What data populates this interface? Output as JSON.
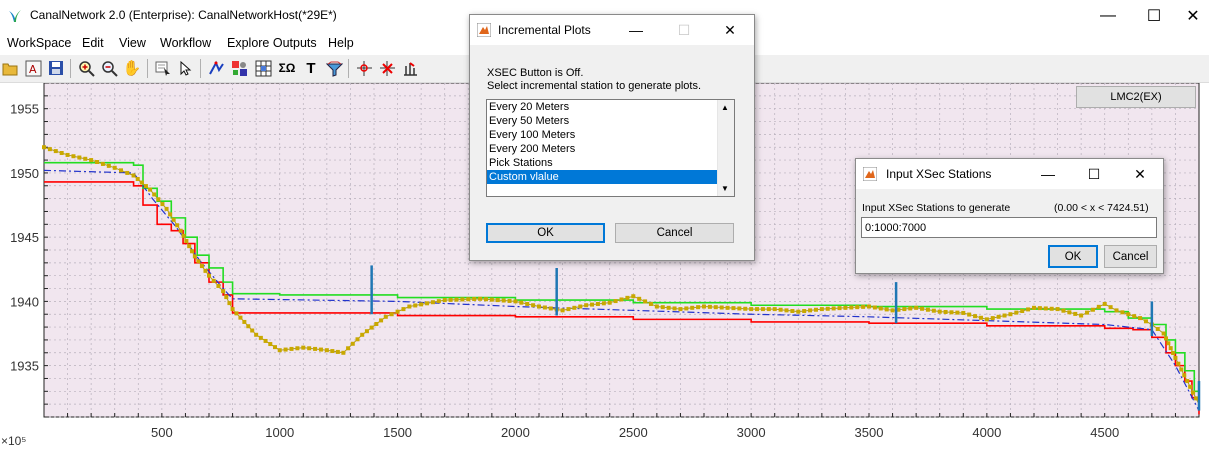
{
  "window": {
    "title": "CanalNetwork 2.0  (Enterprise): CanalNetworkHost(*29E*)",
    "minimize_glyph": "—",
    "maximize_glyph": "☐",
    "close_glyph": "✕"
  },
  "menu": [
    "WorkSpace",
    "Edit",
    "View",
    "Workflow",
    "Explore Outputs",
    "Help"
  ],
  "toolbar_icons": [
    "open-folder-icon",
    "text-style-icon",
    "save-icon",
    "zoom-in-icon",
    "zoom-out-icon",
    "pan-hand-icon",
    "data-cursor-icon",
    "select-arrow-icon",
    "link-icon",
    "settings-icon",
    "grid-icon",
    "sigma-icon",
    "text-icon",
    "layers-icon",
    "pin-icon",
    "delete-pin-icon",
    "marker-icon"
  ],
  "legend_button": "LMC2(EX)",
  "incremental_dialog": {
    "title": "Incremental Plots",
    "message_line1": "XSEC Button is Off.",
    "message_line2": "Select incremental station to generate plots.",
    "options": [
      "Every 20 Meters",
      "Every  50 Meters",
      "Every 100 Meters",
      "Every 200 Meters",
      "Pick Stations",
      "Custom vlalue"
    ],
    "selected_index": 5,
    "ok_label": "OK",
    "cancel_label": "Cancel"
  },
  "xsec_dialog": {
    "title": "Input XSec Stations",
    "prompt": "Input XSec Stations to generate",
    "range": "(0.00 < x < 7424.51)",
    "input_value": "0:1000:7000",
    "ok_label": "OK",
    "cancel_label": "Cancel"
  },
  "chart_data": {
    "type": "line",
    "x_exponent_label": "×10⁵",
    "xlim": [
      0,
      4900
    ],
    "ylim": [
      1931,
      1957
    ],
    "x_ticks": [
      500,
      1000,
      1500,
      2000,
      2500,
      3000,
      3500,
      4000,
      4500
    ],
    "y_ticks": [
      1935,
      1940,
      1945,
      1950,
      1955
    ],
    "background": "#f1e6ef",
    "grid": true,
    "series": [
      {
        "color": "#ff0000",
        "style": "step",
        "x": [
          0,
          380,
          420,
          480,
          540,
          590,
          640,
          700,
          760,
          800,
          1500,
          2000,
          2500,
          3000,
          3500,
          4000,
          4500,
          4620,
          4700,
          4760,
          4800,
          4840,
          4870,
          4900
        ],
        "y": [
          1949.3,
          1949.0,
          1947.5,
          1946.0,
          1945.5,
          1944.5,
          1943.0,
          1941.5,
          1940.5,
          1939.1,
          1938.9,
          1938.8,
          1938.6,
          1938.4,
          1938.3,
          1938.1,
          1937.9,
          1937.8,
          1937.2,
          1936.0,
          1935.0,
          1933.8,
          1932.5,
          1931.2
        ]
      },
      {
        "color": "#22dd22",
        "style": "step",
        "x": [
          0,
          380,
          420,
          480,
          540,
          600,
          650,
          700,
          760,
          800,
          1000,
          1500,
          2000,
          2500,
          3000,
          3500,
          4000,
          4500,
          4600,
          4700,
          4760,
          4800,
          4840,
          4880,
          4900
        ],
        "y": [
          1950.8,
          1950.6,
          1948.8,
          1947.8,
          1946.5,
          1945.0,
          1943.6,
          1942.6,
          1941.5,
          1940.6,
          1940.5,
          1940.3,
          1940.1,
          1939.9,
          1939.7,
          1939.6,
          1939.4,
          1939.2,
          1938.7,
          1938.2,
          1937.0,
          1936.0,
          1934.6,
          1933.0,
          1931.6
        ]
      },
      {
        "color": "#2233cc",
        "style": "dashdot",
        "x": [
          0,
          380,
          460,
          560,
          660,
          760,
          800,
          1500,
          2000,
          2500,
          3000,
          3500,
          4000,
          4500,
          4700,
          4800,
          4900
        ],
        "y": [
          1950.2,
          1950.0,
          1948.0,
          1945.8,
          1943.2,
          1941.0,
          1940.2,
          1940.0,
          1939.6,
          1939.3,
          1939.0,
          1938.8,
          1938.5,
          1938.2,
          1937.8,
          1935.0,
          1931.5
        ]
      },
      {
        "color": "#c9a800",
        "style": "markers",
        "x": [
          0,
          100,
          200,
          300,
          380,
          450,
          520,
          580,
          640,
          700,
          760,
          800,
          900,
          1000,
          1100,
          1200,
          1270,
          1350,
          1450,
          1550,
          1700,
          1850,
          2000,
          2100,
          2200,
          2300,
          2400,
          2500,
          2600,
          2700,
          2800,
          2900,
          3000,
          3100,
          3200,
          3300,
          3400,
          3500,
          3600,
          3700,
          3800,
          3900,
          4000,
          4100,
          4200,
          4300,
          4400,
          4500,
          4550,
          4600,
          4650,
          4700,
          4750,
          4800,
          4850,
          4900
        ],
        "y": [
          1952.0,
          1951.4,
          1951.0,
          1950.4,
          1949.8,
          1948.7,
          1947.2,
          1945.5,
          1943.5,
          1942.0,
          1940.8,
          1939.4,
          1937.4,
          1936.2,
          1936.4,
          1936.2,
          1936.0,
          1937.4,
          1938.8,
          1939.6,
          1940.1,
          1940.2,
          1940.0,
          1939.6,
          1939.3,
          1939.7,
          1939.9,
          1940.4,
          1939.6,
          1939.4,
          1939.6,
          1939.5,
          1939.4,
          1939.4,
          1939.2,
          1939.4,
          1939.5,
          1939.6,
          1939.3,
          1939.5,
          1939.2,
          1939.1,
          1938.6,
          1939.0,
          1939.5,
          1939.4,
          1938.9,
          1939.8,
          1939.3,
          1939.0,
          1938.7,
          1938.2,
          1937.5,
          1935.6,
          1933.8,
          1932.0
        ]
      },
      {
        "color": "#1f77b4",
        "style": "vbars",
        "x": [
          1390,
          2175,
          3615,
          4700,
          4900
        ],
        "y_low": [
          1939.0,
          1938.9,
          1938.3,
          1937.3,
          1931.5
        ],
        "y_high": [
          1942.8,
          1942.6,
          1941.5,
          1940.0,
          1933.8
        ]
      }
    ]
  }
}
